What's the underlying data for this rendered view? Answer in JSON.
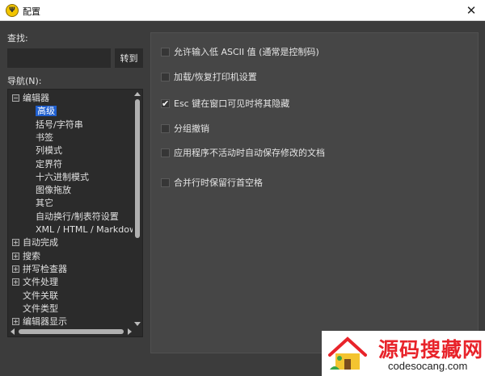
{
  "window": {
    "title": "配置",
    "app_icon_glyph": "Ψ",
    "close_glyph": "✕"
  },
  "search": {
    "label": "查找:",
    "value": "",
    "placeholder": "",
    "goto_label": "转到"
  },
  "nav": {
    "label": "导航(N):",
    "tree": [
      {
        "label": "编辑器",
        "level": 0,
        "expander": "−"
      },
      {
        "label": "高级",
        "level": 1,
        "selected": true
      },
      {
        "label": "括号/字符串",
        "level": 1
      },
      {
        "label": "书签",
        "level": 1
      },
      {
        "label": "列模式",
        "level": 1
      },
      {
        "label": "定界符",
        "level": 1
      },
      {
        "label": "十六进制模式",
        "level": 1
      },
      {
        "label": "图像拖放",
        "level": 1
      },
      {
        "label": "其它",
        "level": 1
      },
      {
        "label": "自动换行/制表符设置",
        "level": 1
      },
      {
        "label": "XML / HTML / Markdown",
        "level": 1
      },
      {
        "label": "自动完成",
        "level": 0,
        "expander": "+"
      },
      {
        "label": "搜索",
        "level": 0,
        "expander": "+"
      },
      {
        "label": "拼写检查器",
        "level": 0,
        "expander": "+"
      },
      {
        "label": "文件处理",
        "level": 0,
        "expander": "+"
      },
      {
        "label": "文件关联",
        "level": 0
      },
      {
        "label": "文件类型",
        "level": 0
      },
      {
        "label": "编辑器显示",
        "level": 0,
        "expander": "+"
      }
    ]
  },
  "options": [
    {
      "label": "允许输入低 ASCII 值 (通常是控制码)",
      "checked": false
    },
    {
      "label": "加载/恢复打印机设置",
      "checked": false
    },
    {
      "label": "Esc 键在窗口可见时将其隐藏",
      "checked": true
    },
    {
      "label": "分组撤销",
      "checked": false
    },
    {
      "label": "应用程序不活动时自动保存修改的文档",
      "checked": false
    },
    {
      "label": "合并行时保留行首空格",
      "checked": false
    }
  ],
  "watermark": {
    "main": "源码搜藏网",
    "sub": "codesocang.com"
  },
  "colors": {
    "background": "#3c3c3c",
    "panel": "#464646",
    "tree_bg": "#2b2b2b",
    "selection": "#1f5fcf",
    "watermark_red": "#e8232a"
  }
}
